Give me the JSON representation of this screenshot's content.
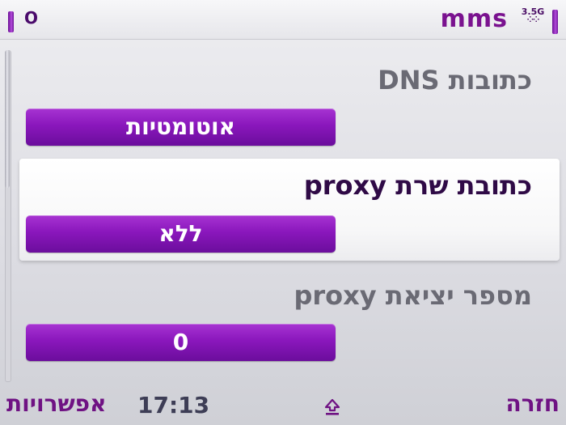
{
  "status_bar": {
    "title": "mms",
    "left_indicator": "Ο",
    "network_indicator": "3.5G",
    "left_signal_icon": "signal-strength-bar",
    "right_signal_icon": "battery-level-bar",
    "accent_color": "#8a17bc"
  },
  "settings": [
    {
      "label": "כתובות DNS",
      "value": "אוטומטיות"
    },
    {
      "label": "כתובת שרת proxy",
      "value": "ללא"
    },
    {
      "label": "מספר יציאת proxy",
      "value": "0"
    }
  ],
  "softkeys": {
    "left": "אפשרויות",
    "right": "חזרה",
    "clock": "17:13",
    "center_icon": "upload-icon"
  }
}
